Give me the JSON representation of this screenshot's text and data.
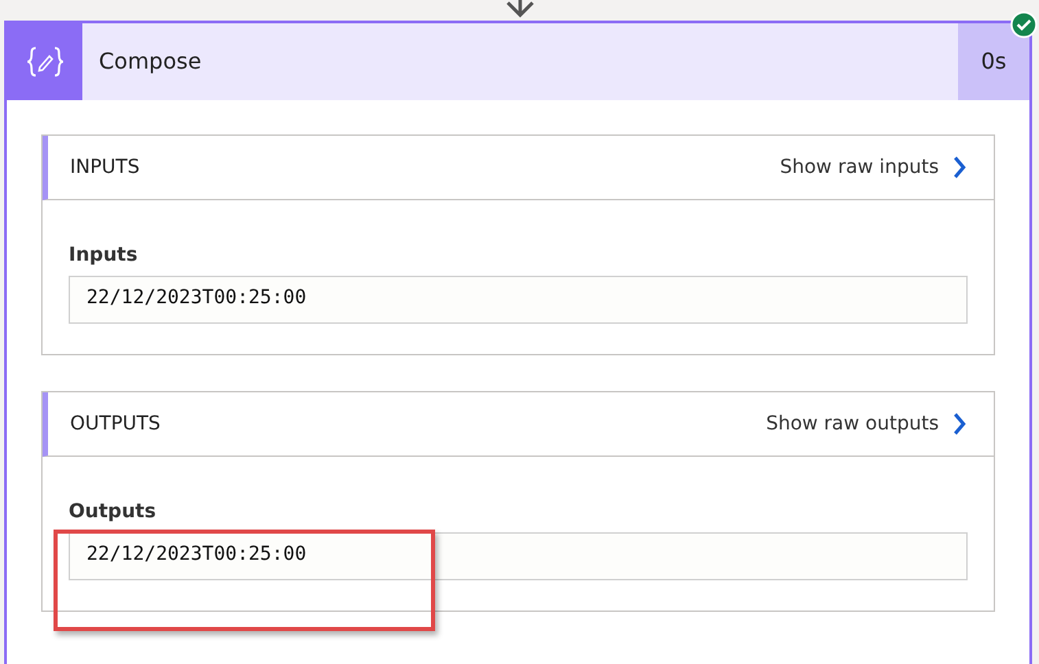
{
  "action": {
    "title": "Compose",
    "duration": "0s",
    "succeeded": true
  },
  "sections": [
    {
      "heading": "INPUTS",
      "link": "Show raw inputs",
      "label": "Inputs",
      "value": "22/12/2023T00:25:00",
      "highlighted": false
    },
    {
      "heading": "OUTPUTS",
      "link": "Show raw outputs",
      "label": "Outputs",
      "value": "22/12/2023T00:25:00",
      "highlighted": true
    }
  ]
}
